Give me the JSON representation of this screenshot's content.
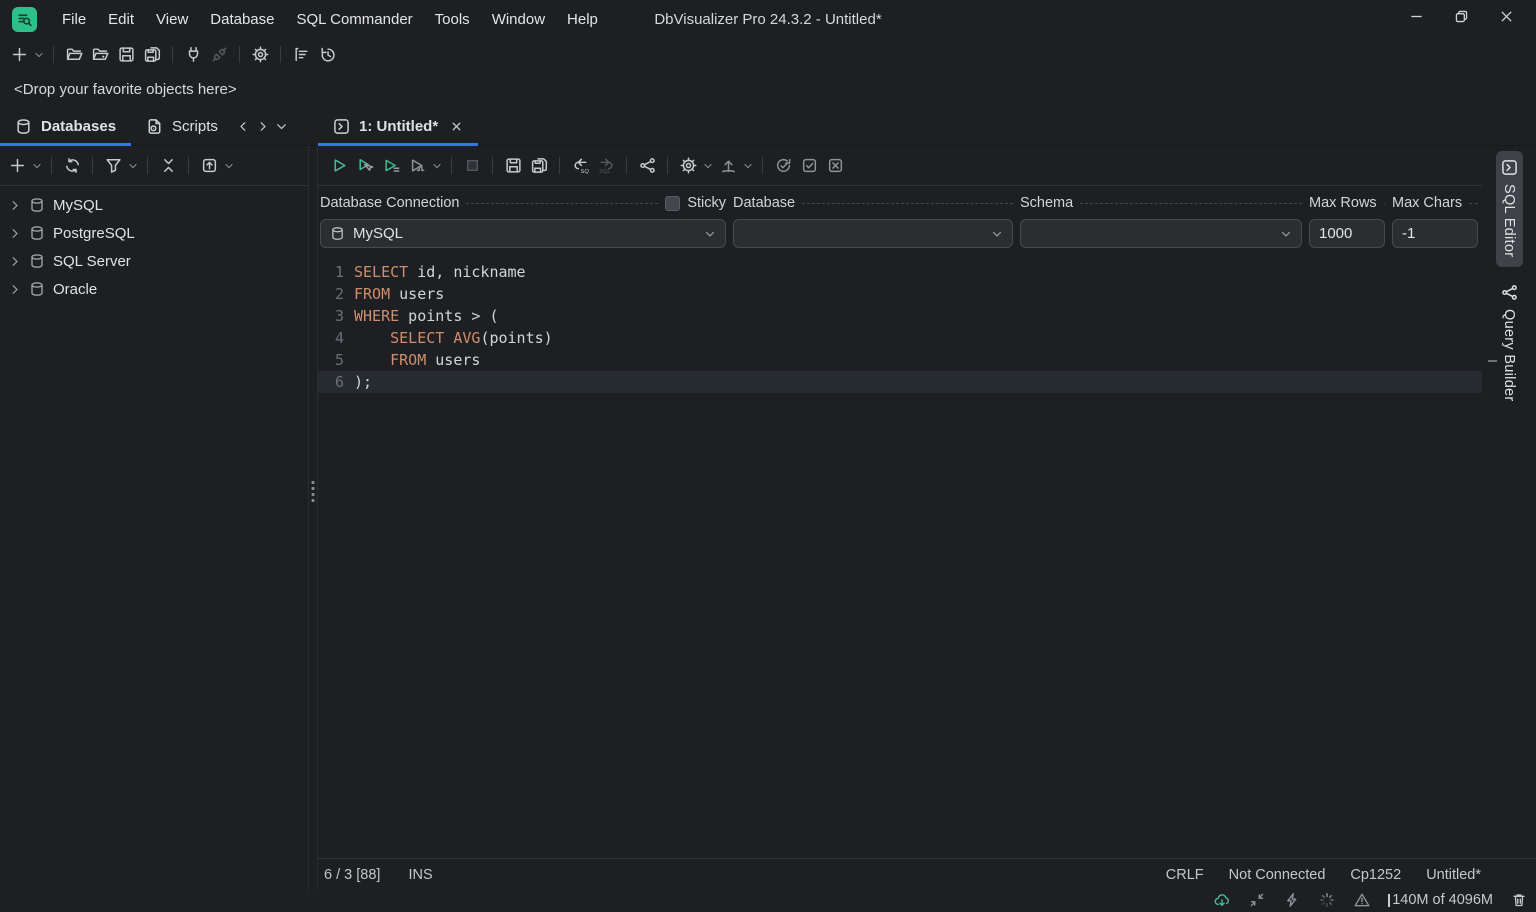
{
  "colors": {
    "bg": "#1e1f22",
    "accent_blue": "#3574f0",
    "accent_green": "#43bd92",
    "keyword_orange": "#cf8e6d",
    "panel_input": "#2b2d31"
  },
  "titlebar": {
    "title": "DbVisualizer Pro 24.3.2 - Untitled*",
    "menus": [
      "File",
      "Edit",
      "View",
      "Database",
      "SQL Commander",
      "Tools",
      "Window",
      "Help"
    ]
  },
  "favorites_bar": {
    "hint": "<Drop your favorite objects here>"
  },
  "tabs": {
    "databases_label": "Databases",
    "scripts_label": "Scripts",
    "editor_tab_label": "1: Untitled*"
  },
  "toolbars": {
    "main": [
      {
        "i": "plus"
      },
      {
        "c": 1
      },
      {
        "s": 1
      },
      {
        "i": "folder-open"
      },
      {
        "i": "folder-open-dot"
      },
      {
        "i": "save"
      },
      {
        "i": "save-as"
      },
      {
        "s": 1
      },
      {
        "i": "plug"
      },
      {
        "i": "plug-off",
        "v": "dis"
      },
      {
        "s": 1
      },
      {
        "i": "gear"
      },
      {
        "s": 1
      },
      {
        "i": "chart"
      },
      {
        "i": "clock-history"
      }
    ],
    "left": [
      {
        "i": "plus"
      },
      {
        "c": 1
      },
      {
        "s": 1
      },
      {
        "i": "refresh"
      },
      {
        "s": 1
      },
      {
        "i": "funnel"
      },
      {
        "c": 1
      },
      {
        "s": 1
      },
      {
        "i": "collapse-vert"
      },
      {
        "s": 1
      },
      {
        "i": "export-box"
      },
      {
        "c": 1
      }
    ],
    "sql": [
      {
        "i": "play",
        "v": "green"
      },
      {
        "i": "play-cursor",
        "v": "green"
      },
      {
        "i": "play-list",
        "v": "green"
      },
      {
        "i": "play-wave",
        "v": "dim"
      },
      {
        "c": 1
      },
      {
        "s": 1
      },
      {
        "i": "stop",
        "v": "dis"
      },
      {
        "s": 1
      },
      {
        "i": "save"
      },
      {
        "i": "save-as"
      },
      {
        "s": 1
      },
      {
        "i": "sql-undo"
      },
      {
        "i": "sql-redo",
        "v": "dis"
      },
      {
        "s": 1
      },
      {
        "i": "share-nodes"
      },
      {
        "s": 1
      },
      {
        "i": "gear"
      },
      {
        "c": 1
      },
      {
        "i": "arrow-up-curve",
        "v": "dim"
      },
      {
        "c": 1
      },
      {
        "s": 1
      },
      {
        "i": "validate",
        "v": "dim"
      },
      {
        "i": "check-square",
        "v": "dim"
      },
      {
        "i": "x-square",
        "v": "dim"
      }
    ],
    "status": [
      {
        "i": "cloud-down",
        "v": "green"
      },
      {
        "i": "collapse-diag",
        "v": "dim"
      },
      {
        "i": "bolt",
        "v": "dim"
      },
      {
        "i": "spinner",
        "v": "dim"
      },
      {
        "i": "warn",
        "v": "dim"
      }
    ]
  },
  "left_panel": {
    "tree": [
      {
        "label": "MySQL"
      },
      {
        "label": "PostgreSQL"
      },
      {
        "label": "SQL Server"
      },
      {
        "label": "Oracle"
      }
    ]
  },
  "connection_bar": {
    "connection_label": "Database Connection",
    "sticky_label": "Sticky",
    "database_label": "Database",
    "schema_label": "Schema",
    "max_rows_label": "Max Rows",
    "max_chars_label": "Max Chars",
    "connection_value": "MySQL",
    "database_value": "",
    "schema_value": "",
    "max_rows_value": "1000",
    "max_chars_value": "-1"
  },
  "editor": {
    "active_line": 6,
    "lines": [
      {
        "n": 1,
        "seg": [
          {
            "t": "SELECT",
            "k": 1
          },
          {
            "t": " id, nickname"
          }
        ]
      },
      {
        "n": 2,
        "seg": [
          {
            "t": "FROM",
            "k": 1
          },
          {
            "t": " users"
          }
        ]
      },
      {
        "n": 3,
        "seg": [
          {
            "t": "WHERE",
            "k": 1
          },
          {
            "t": " points > ("
          }
        ]
      },
      {
        "n": 4,
        "seg": [
          {
            "t": "    "
          },
          {
            "t": "SELECT",
            "k": 1
          },
          {
            "t": " "
          },
          {
            "t": "AVG",
            "k": 1
          },
          {
            "t": "(points)"
          }
        ]
      },
      {
        "n": 5,
        "seg": [
          {
            "t": "    "
          },
          {
            "t": "FROM",
            "k": 1
          },
          {
            "t": " users"
          }
        ]
      },
      {
        "n": 6,
        "seg": [
          {
            "t": ");"
          }
        ]
      }
    ]
  },
  "right_tabs": {
    "sql_editor_label": "SQL Editor",
    "query_builder_label": "Query Builder"
  },
  "editor_status": {
    "position": "6 / 3 [88]",
    "mode": "INS",
    "line_ending": "CRLF",
    "connection": "Not Connected",
    "encoding": "Cp1252",
    "file": "Untitled*"
  },
  "app_status": {
    "memory": "140M of 4096M"
  }
}
